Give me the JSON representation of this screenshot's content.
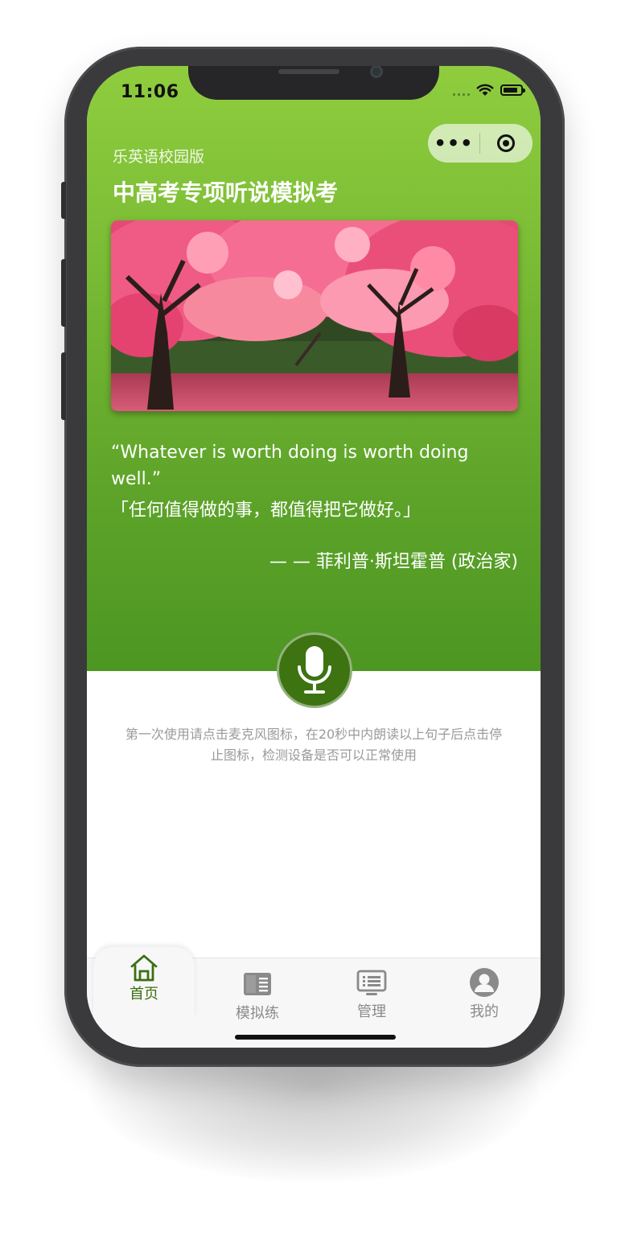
{
  "status_bar": {
    "time": "11:06"
  },
  "capsule": {
    "more_label": "•••"
  },
  "header": {
    "subtitle": "乐英语校园版",
    "title": "中高考专项听说模拟考"
  },
  "quote": {
    "english": "“Whatever is worth doing is worth doing well.”",
    "chinese": "「任何值得做的事，都值得把它做好。」",
    "author": "— — 菲利普·斯坦霍普 (政治家)"
  },
  "hint": "第一次使用请点击麦克风图标，在20秒中内朗读以上句子后点击停止图标，检测设备是否可以正常使用",
  "tabs": [
    {
      "label": "首页",
      "icon": "home-icon",
      "active": true
    },
    {
      "label": "模拟练",
      "icon": "book-icon",
      "active": false
    },
    {
      "label": "管理",
      "icon": "list-icon",
      "active": false
    },
    {
      "label": "我的",
      "icon": "user-icon",
      "active": false
    }
  ],
  "colors": {
    "accent": "#3b6f12",
    "hero_top": "#8fcd3e",
    "hero_bottom": "#4c9622",
    "mic_button": "#3d7311",
    "hint_text": "#9a9a9a"
  }
}
